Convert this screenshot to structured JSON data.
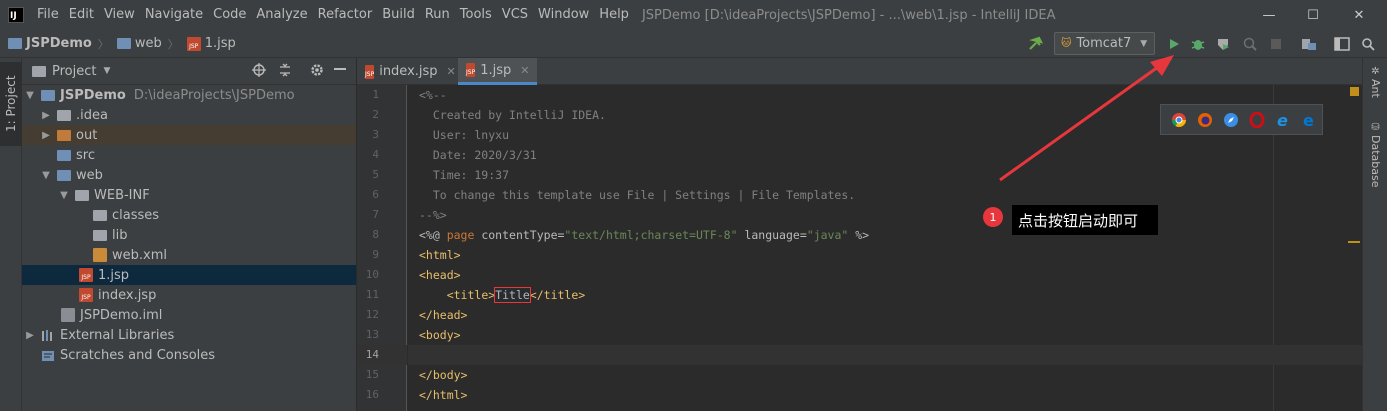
{
  "window": {
    "title": "JSPDemo [D:\\ideaProjects\\JSPDemo] - ...\\web\\1.jsp - IntelliJ IDEA",
    "menu": [
      "File",
      "Edit",
      "View",
      "Navigate",
      "Code",
      "Analyze",
      "Refactor",
      "Build",
      "Run",
      "Tools",
      "VCS",
      "Window",
      "Help"
    ],
    "controls": {
      "minimize": "—",
      "maximize": "☐",
      "close": "✕"
    }
  },
  "navbar": {
    "breadcrumbs": [
      "JSPDemo",
      "web",
      "1.jsp"
    ],
    "run_config": "Tomcat7"
  },
  "left_strip": {
    "project_tab": "1: Project"
  },
  "project_panel": {
    "title": "Project",
    "tree": [
      {
        "label": "JSPDemo",
        "sub": "D:\\ideaProjects\\JSPDemo",
        "icon": "module-folder-icon"
      },
      {
        "label": ".idea",
        "icon": "folder-icon"
      },
      {
        "label": "out",
        "icon": "folder-orange-icon"
      },
      {
        "label": "src",
        "icon": "source-folder-icon"
      },
      {
        "label": "web",
        "icon": "web-folder-icon"
      },
      {
        "label": "WEB-INF",
        "icon": "folder-icon"
      },
      {
        "label": "classes",
        "icon": "folder-icon"
      },
      {
        "label": "lib",
        "icon": "folder-icon"
      },
      {
        "label": "web.xml",
        "icon": "xml-file-icon"
      },
      {
        "label": "1.jsp",
        "icon": "jsp-file-icon"
      },
      {
        "label": "index.jsp",
        "icon": "jsp-file-icon"
      },
      {
        "label": "JSPDemo.iml",
        "icon": "iml-file-icon"
      },
      {
        "label": "External Libraries",
        "icon": "libraries-icon"
      },
      {
        "label": "Scratches and Consoles",
        "icon": "scratches-icon"
      }
    ]
  },
  "editor": {
    "tabs": [
      {
        "label": "index.jsp"
      },
      {
        "label": "1.jsp"
      }
    ],
    "line_numbers": [
      "1",
      "2",
      "3",
      "4",
      "5",
      "6",
      "7",
      "8",
      "9",
      "10",
      "11",
      "12",
      "13",
      "14",
      "15",
      "16"
    ],
    "lines": {
      "l1": "<%--",
      "l2": "  Created by IntelliJ IDEA.",
      "l3": "  User: lnyxu",
      "l4": "  Date: 2020/3/31",
      "l5": "  Time: 19:37",
      "l6": "  To change this template use File | Settings | File Templates.",
      "l7": "--%>",
      "l8_open": "<%@ ",
      "l8_kw": "page",
      "l8_attr1": " contentType=",
      "l8_val1": "\"text/html;charset=UTF-8\"",
      "l8_attr2": " language=",
      "l8_val2": "\"java\"",
      "l8_close": " %>",
      "l9": "<html>",
      "l10": "<head>",
      "l11_indent": "    ",
      "l11_open": "<title>",
      "l11_text": "Title",
      "l11_close": "</title>",
      "l12": "</head>",
      "l13": "<body>",
      "l15": "</body>",
      "l16": "</html>"
    }
  },
  "right_strip": {
    "tabs": [
      "Ant",
      "Database"
    ]
  },
  "annotation": {
    "step": "1",
    "text": "点击按钮启动即可"
  },
  "colors": {
    "arrow": "#e8373c",
    "accent": "#4a88c7"
  }
}
